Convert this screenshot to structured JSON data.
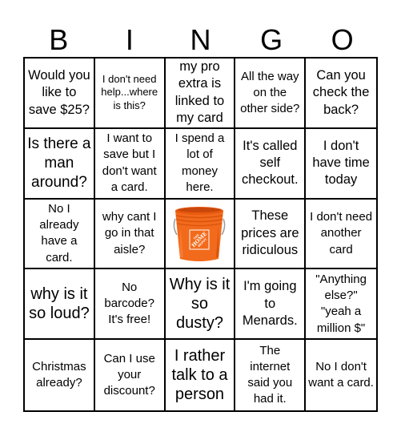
{
  "header": {
    "letters": [
      "B",
      "I",
      "N",
      "G",
      "O"
    ]
  },
  "grid": {
    "rows": [
      [
        {
          "text": "Would you like to save $25?",
          "size": "l"
        },
        {
          "text": "I don't need help...where is this?",
          "size": "s"
        },
        {
          "text": "my pro extra is linked to my card",
          "size": "l"
        },
        {
          "text": "All the way on the other side?",
          "size": "m"
        },
        {
          "text": "Can you check the back?",
          "size": "l"
        }
      ],
      [
        {
          "text": "Is there a man around?",
          "size": "xl"
        },
        {
          "text": "I want to save but I don't want a card.",
          "size": "m"
        },
        {
          "text": "I spend a lot of money here.",
          "size": "m"
        },
        {
          "text": "It's called self checkout.",
          "size": "l"
        },
        {
          "text": "I don't have time today",
          "size": "l"
        }
      ],
      [
        {
          "text": "No I already have a card.",
          "size": "m"
        },
        {
          "text": "why cant I go in that aisle?",
          "size": "m"
        },
        {
          "text": "",
          "size": "free",
          "image": "home-depot-bucket",
          "image_label": "THE HOME DEPOT"
        },
        {
          "text": "These prices are ridiculous",
          "size": "m"
        },
        {
          "text": "I don't need another card",
          "size": "m"
        }
      ],
      [
        {
          "text": "why is it so loud?",
          "size": "xxl"
        },
        {
          "text": "No barcode? It's free!",
          "size": "m"
        },
        {
          "text": "Why is it so dusty?",
          "size": "xxl"
        },
        {
          "text": "I'm going to Menards.",
          "size": "l"
        },
        {
          "text": "\"Anything else?\" \"yeah a million $\"",
          "size": "m"
        }
      ],
      [
        {
          "text": "Christmas already?",
          "size": "m"
        },
        {
          "text": "Can I use your discount?",
          "size": "m"
        },
        {
          "text": "I rather talk to a person",
          "size": "xxl"
        },
        {
          "text": "The internet said you had it.",
          "size": "m"
        },
        {
          "text": "No I don't want a card.",
          "size": "m"
        }
      ]
    ]
  },
  "colors": {
    "bucket_orange": "#f26a1b",
    "bucket_dark": "#c9470a",
    "grid_line": "#000000"
  }
}
